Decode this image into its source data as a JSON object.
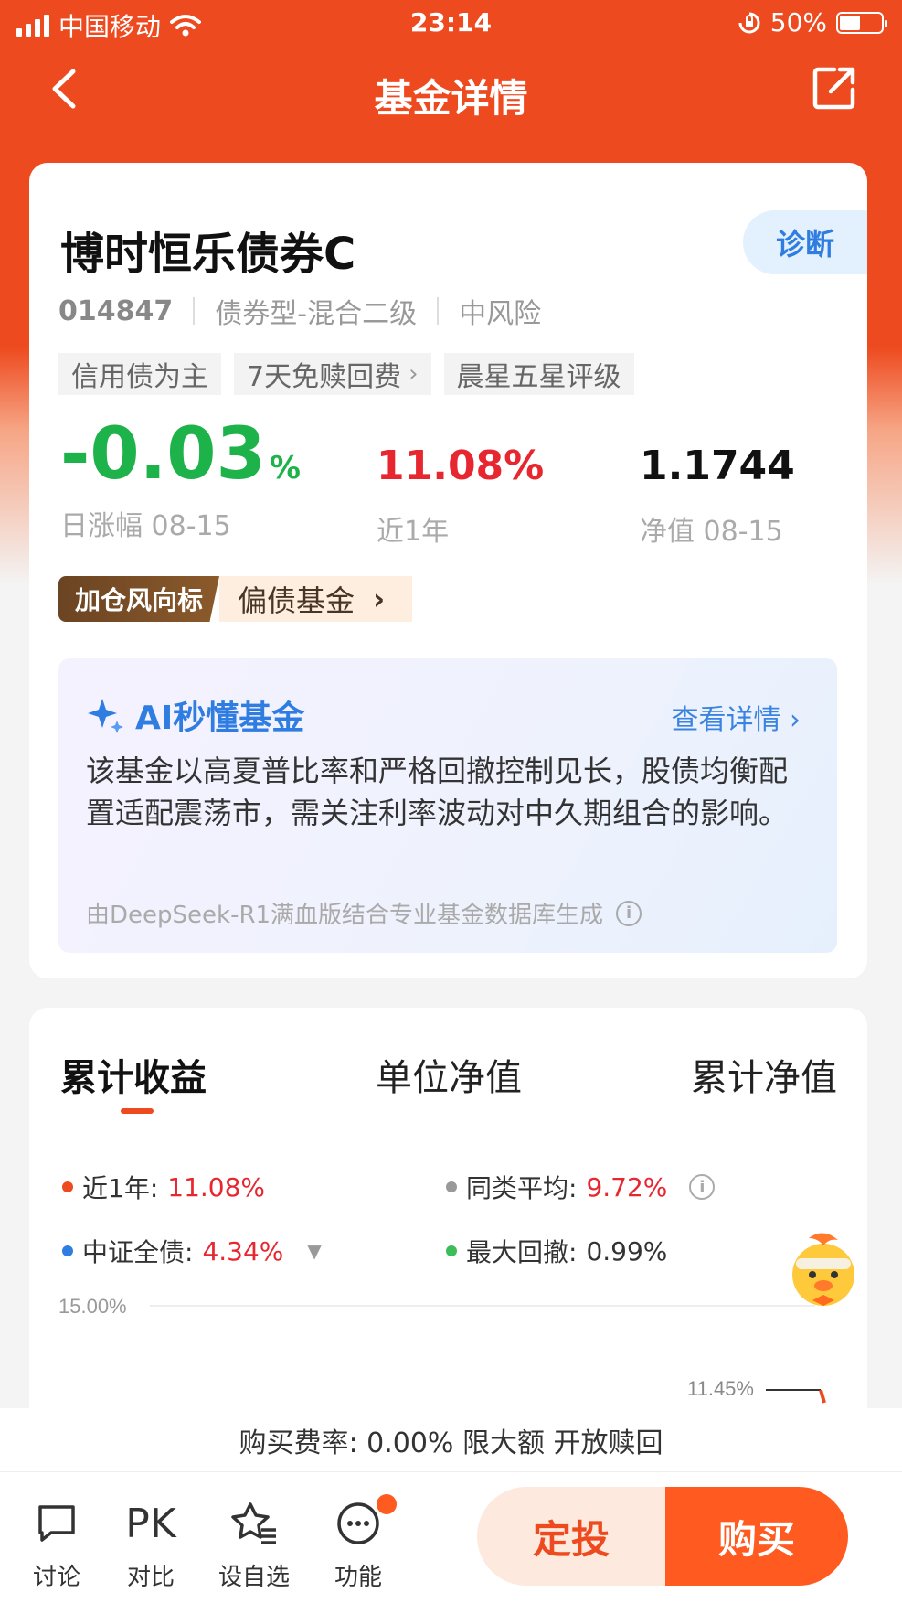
{
  "status_bar": {
    "carrier": "中国移动",
    "time": "23:14",
    "battery": "50%",
    "battery_level": 0.5
  },
  "nav": {
    "title": "基金详情"
  },
  "fund": {
    "name": "博时恒乐债券C",
    "code": "014847",
    "type": "债券型-混合二级",
    "risk": "中风险",
    "tags": [
      "信用债为主",
      "7天免赎回费",
      "晨星五星评级"
    ],
    "diagnose_label": "诊断",
    "daily_change": "-0.03",
    "daily_change_unit": "%",
    "daily_change_label": "日涨幅 08-15",
    "one_year": "11.08%",
    "one_year_label": "近1年",
    "nav_value": "1.1744",
    "nav_label": "净值 08-15",
    "vane_badge": "加仓风向标",
    "vane_text": "偏债基金"
  },
  "ai": {
    "title": "AI秒懂基金",
    "more": "查看详情",
    "text": "该基金以高夏普比率和严格回撤控制见长，股债均衡配置适配震荡市，需关注利率波动对中久期组合的影响。",
    "footer": "由DeepSeek-R1满血版结合专业基金数据库生成"
  },
  "chart_tabs": [
    "累计收益",
    "单位净值",
    "累计净值"
  ],
  "legend": {
    "one_year_label": "近1年:",
    "one_year_value": "11.08%",
    "peer_label": "同类平均:",
    "peer_value": "9.72%",
    "index_label": "中证全债:",
    "index_value": "4.34%",
    "drawdown_label": "最大回撤:",
    "drawdown_value": "0.99%"
  },
  "colors": {
    "fund": "#ee4a1f",
    "peer": "#999999",
    "index": "#2f7de1",
    "drawdown": "#3dbd5a"
  },
  "chart_data": {
    "type": "line",
    "y_tick_label": "15.00%",
    "y_tick": 15.0,
    "last_point_label": "11.45%",
    "last_point_value": 11.45
  },
  "fee_bar": "购买费率: 0.00% 限大额 开放赎回",
  "tabbar": {
    "items": [
      "讨论",
      "对比",
      "设自选",
      "功能"
    ],
    "pk": "PK",
    "sip": "定投",
    "buy": "购买"
  }
}
